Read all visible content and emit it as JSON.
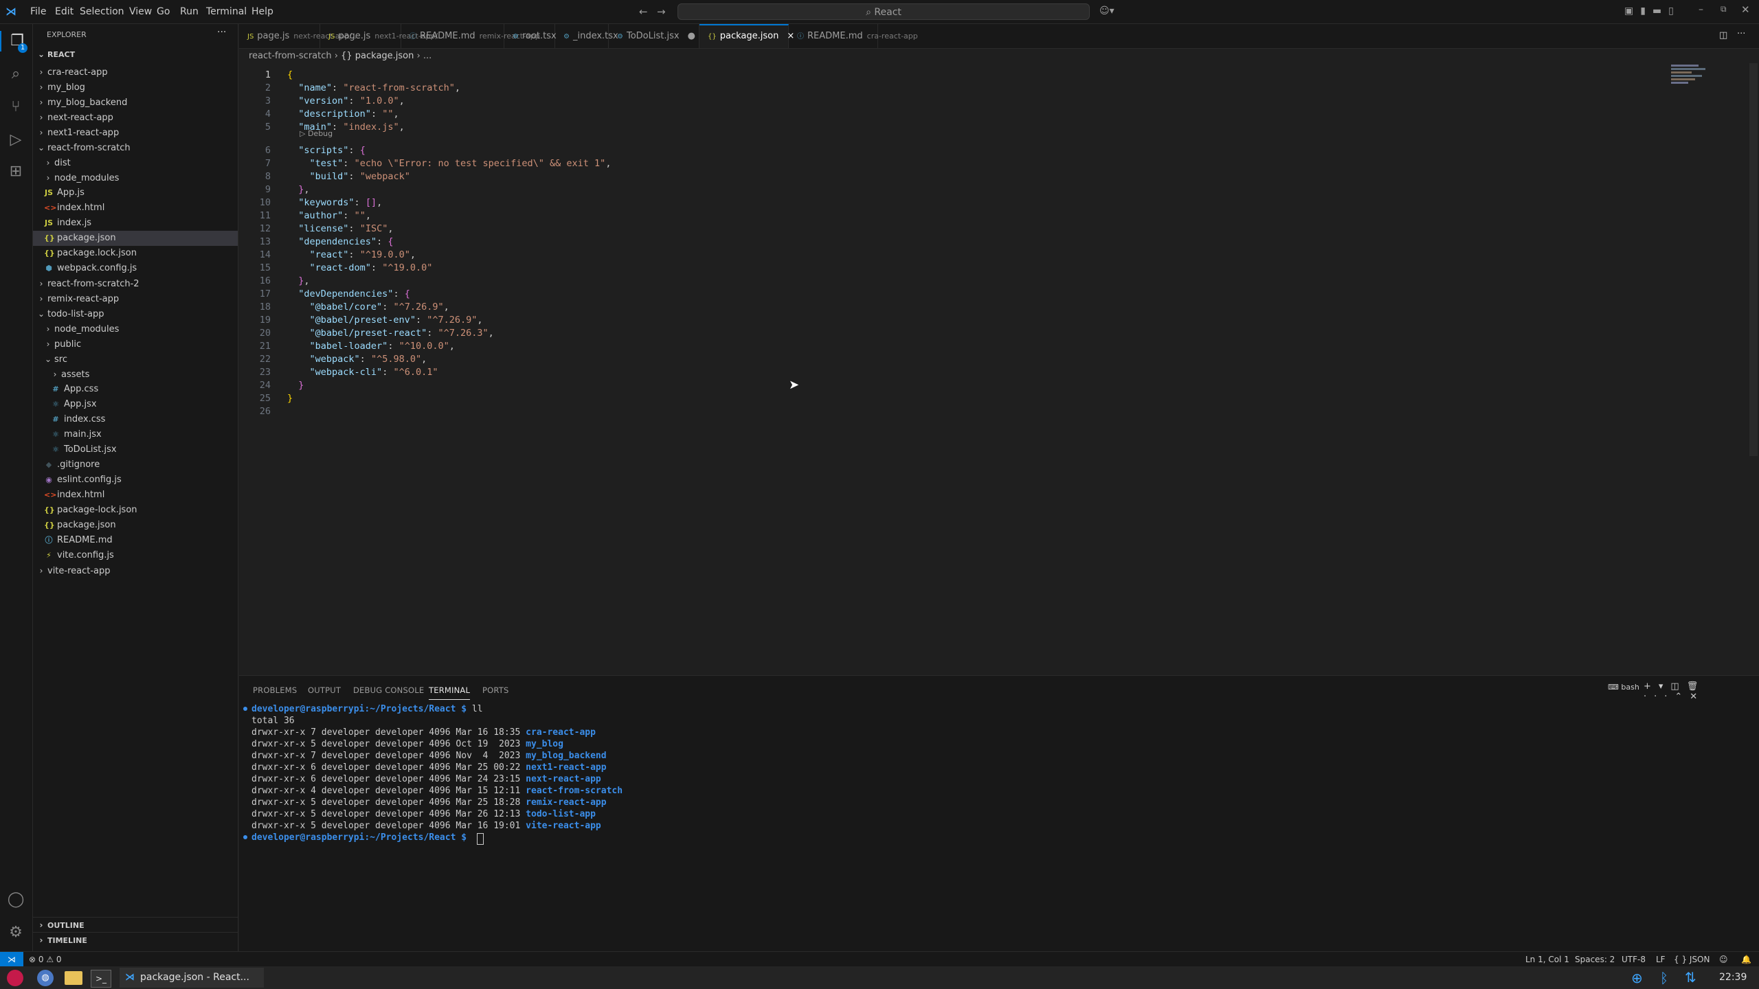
{
  "titlebar": {
    "menu": [
      "File",
      "Edit",
      "Selection",
      "View",
      "Go",
      "Run",
      "Terminal",
      "Help"
    ],
    "search": "React"
  },
  "activity": {
    "badge": "1"
  },
  "explorer": {
    "title": "EXPLORER",
    "root": "REACT",
    "items": [
      {
        "label": "cra-react-app",
        "depth": 1,
        "type": "folder",
        "open": false
      },
      {
        "label": "my_blog",
        "depth": 1,
        "type": "folder",
        "open": false
      },
      {
        "label": "my_blog_backend",
        "depth": 1,
        "type": "folder",
        "open": false
      },
      {
        "label": "next-react-app",
        "depth": 1,
        "type": "folder",
        "open": false
      },
      {
        "label": "next1-react-app",
        "depth": 1,
        "type": "folder",
        "open": false
      },
      {
        "label": "react-from-scratch",
        "depth": 1,
        "type": "folder",
        "open": true
      },
      {
        "label": "dist",
        "depth": 2,
        "type": "folder",
        "open": false
      },
      {
        "label": "node_modules",
        "depth": 2,
        "type": "folder",
        "open": false
      },
      {
        "label": "App.js",
        "depth": 2,
        "type": "js"
      },
      {
        "label": "index.html",
        "depth": 2,
        "type": "html"
      },
      {
        "label": "index.js",
        "depth": 2,
        "type": "js"
      },
      {
        "label": "package.json",
        "depth": 2,
        "type": "json",
        "selected": true
      },
      {
        "label": "package.lock.json",
        "depth": 2,
        "type": "json"
      },
      {
        "label": "webpack.config.js",
        "depth": 2,
        "type": "webpack"
      },
      {
        "label": "react-from-scratch-2",
        "depth": 1,
        "type": "folder",
        "open": false
      },
      {
        "label": "remix-react-app",
        "depth": 1,
        "type": "folder",
        "open": false
      },
      {
        "label": "todo-list-app",
        "depth": 1,
        "type": "folder",
        "open": true
      },
      {
        "label": "node_modules",
        "depth": 2,
        "type": "folder",
        "open": false
      },
      {
        "label": "public",
        "depth": 2,
        "type": "folder",
        "open": false
      },
      {
        "label": "src",
        "depth": 2,
        "type": "folder",
        "open": true
      },
      {
        "label": "assets",
        "depth": 3,
        "type": "folder",
        "open": false
      },
      {
        "label": "App.css",
        "depth": 3,
        "type": "css"
      },
      {
        "label": "App.jsx",
        "depth": 3,
        "type": "jsx"
      },
      {
        "label": "index.css",
        "depth": 3,
        "type": "css"
      },
      {
        "label": "main.jsx",
        "depth": 3,
        "type": "jsx"
      },
      {
        "label": "ToDoList.jsx",
        "depth": 3,
        "type": "jsx"
      },
      {
        "label": ".gitignore",
        "depth": 2,
        "type": "git"
      },
      {
        "label": "eslint.config.js",
        "depth": 2,
        "type": "eslint"
      },
      {
        "label": "index.html",
        "depth": 2,
        "type": "html"
      },
      {
        "label": "package-lock.json",
        "depth": 2,
        "type": "json"
      },
      {
        "label": "package.json",
        "depth": 2,
        "type": "json"
      },
      {
        "label": "README.md",
        "depth": 2,
        "type": "md"
      },
      {
        "label": "vite.config.js",
        "depth": 2,
        "type": "vite"
      },
      {
        "label": "vite-react-app",
        "depth": 1,
        "type": "folder",
        "open": false
      }
    ],
    "outline": "OUTLINE",
    "timeline": "TIMELINE"
  },
  "tabs": [
    {
      "icon": "JS",
      "label": "page.js",
      "desc": "next-react-app/..."
    },
    {
      "icon": "JS",
      "label": "page.js",
      "desc": "next1-react-app/..."
    },
    {
      "icon": "ⓘ",
      "label": "README.md",
      "desc": "remix-react-app"
    },
    {
      "icon": "⚙",
      "label": "root.tsx",
      "desc": ""
    },
    {
      "icon": "⚙",
      "label": "_index.tsx",
      "desc": ""
    },
    {
      "icon": "⚙",
      "label": "ToDoList.jsx",
      "desc": "",
      "dirty": "●"
    },
    {
      "icon": "{}",
      "label": "package.json",
      "desc": "",
      "active": true,
      "close": "×"
    },
    {
      "icon": "ⓘ",
      "label": "README.md",
      "desc": "cra-react-app"
    }
  ],
  "breadcrumb": {
    "folder": "react-from-scratch",
    "sep": "›",
    "file": "{} package.json",
    "more": "› ..."
  },
  "codelens": "▷ Debug",
  "code_lines": [
    {
      "n": "1",
      "html": "<span class='p1'>{</span>"
    },
    {
      "n": "2",
      "html": "  <span class='k'>\"name\"</span>: <span class='s'>\"react-from-scratch\"</span>,"
    },
    {
      "n": "3",
      "html": "  <span class='k'>\"version\"</span>: <span class='s'>\"1.0.0\"</span>,"
    },
    {
      "n": "4",
      "html": "  <span class='k'>\"description\"</span>: <span class='s'>\"\"</span>,"
    },
    {
      "n": "5",
      "html": "  <span class='k'>\"main\"</span>: <span class='s'>\"index.js\"</span>,"
    },
    {
      "n": "6",
      "html": "  <span class='k'>\"scripts\"</span>: <span class='p2'>{</span>"
    },
    {
      "n": "7",
      "html": "    <span class='k'>\"test\"</span>: <span class='s'>\"echo \\\"Error: no test specified\\\" &amp;&amp; exit 1\"</span>,"
    },
    {
      "n": "8",
      "html": "    <span class='k'>\"build\"</span>: <span class='s'>\"webpack\"</span>"
    },
    {
      "n": "9",
      "html": "  <span class='p2'>}</span>,"
    },
    {
      "n": "10",
      "html": "  <span class='k'>\"keywords\"</span>: <span class='p2'>[]</span>,"
    },
    {
      "n": "11",
      "html": "  <span class='k'>\"author\"</span>: <span class='s'>\"\"</span>,"
    },
    {
      "n": "12",
      "html": "  <span class='k'>\"license\"</span>: <span class='s'>\"ISC\"</span>,"
    },
    {
      "n": "13",
      "html": "  <span class='k'>\"dependencies\"</span>: <span class='p2'>{</span>"
    },
    {
      "n": "14",
      "html": "    <span class='k'>\"react\"</span>: <span class='s'>\"^19.0.0\"</span>,"
    },
    {
      "n": "15",
      "html": "    <span class='k'>\"react-dom\"</span>: <span class='s'>\"^19.0.0\"</span>"
    },
    {
      "n": "16",
      "html": "  <span class='p2'>}</span>,"
    },
    {
      "n": "17",
      "html": "  <span class='k'>\"devDependencies\"</span>: <span class='p2'>{</span>"
    },
    {
      "n": "18",
      "html": "    <span class='k'>\"@babel/core\"</span>: <span class='s'>\"^7.26.9\"</span>,"
    },
    {
      "n": "19",
      "html": "    <span class='k'>\"@babel/preset-env\"</span>: <span class='s'>\"^7.26.9\"</span>,"
    },
    {
      "n": "20",
      "html": "    <span class='k'>\"@babel/preset-react\"</span>: <span class='s'>\"^7.26.3\"</span>,"
    },
    {
      "n": "21",
      "html": "    <span class='k'>\"babel-loader\"</span>: <span class='s'>\"^10.0.0\"</span>,"
    },
    {
      "n": "22",
      "html": "    <span class='k'>\"webpack\"</span>: <span class='s'>\"^5.98.0\"</span>,"
    },
    {
      "n": "23",
      "html": "    <span class='k'>\"webpack-cli\"</span>: <span class='s'>\"^6.0.1\"</span>"
    },
    {
      "n": "24",
      "html": "  <span class='p2'>}</span>"
    },
    {
      "n": "25",
      "html": "<span class='p1'>}</span>"
    },
    {
      "n": "26",
      "html": ""
    }
  ],
  "panel": {
    "tabs": [
      "PROBLEMS",
      "OUTPUT",
      "DEBUG CONSOLE",
      "TERMINAL",
      "PORTS"
    ],
    "active": "TERMINAL",
    "shell": "bash"
  },
  "terminal": {
    "prompt": "developer@raspberrypi:~/Projects/React $",
    "command": "ll",
    "total": "total 36",
    "entries": [
      {
        "meta": "drwxr-xr-x 7 developer developer 4096 Mar 16 18:35",
        "name": "cra-react-app"
      },
      {
        "meta": "drwxr-xr-x 5 developer developer 4096 Oct 19  2023",
        "name": "my_blog"
      },
      {
        "meta": "drwxr-xr-x 7 developer developer 4096 Nov  4  2023",
        "name": "my_blog_backend"
      },
      {
        "meta": "drwxr-xr-x 6 developer developer 4096 Mar 25 00:22",
        "name": "next1-react-app"
      },
      {
        "meta": "drwxr-xr-x 6 developer developer 4096 Mar 24 23:15",
        "name": "next-react-app"
      },
      {
        "meta": "drwxr-xr-x 4 developer developer 4096 Mar 15 12:11",
        "name": "react-from-scratch"
      },
      {
        "meta": "drwxr-xr-x 5 developer developer 4096 Mar 25 18:28",
        "name": "remix-react-app"
      },
      {
        "meta": "drwxr-xr-x 5 developer developer 4096 Mar 26 12:13",
        "name": "todo-list-app"
      },
      {
        "meta": "drwxr-xr-x 5 developer developer 4096 Mar 16 19:01",
        "name": "vite-react-app"
      }
    ]
  },
  "statusbar": {
    "errors": "⊗ 0 ⚠ 0",
    "position": "Ln 1, Col 1",
    "spaces": "Spaces: 2",
    "encoding": "UTF-8",
    "eol": "LF",
    "language": "{ } JSON"
  },
  "taskbar": {
    "window": "package.json - React...",
    "time": "22:39"
  },
  "colors": {
    "accent": "#0078d4",
    "folder_link": "#3b8eea"
  }
}
